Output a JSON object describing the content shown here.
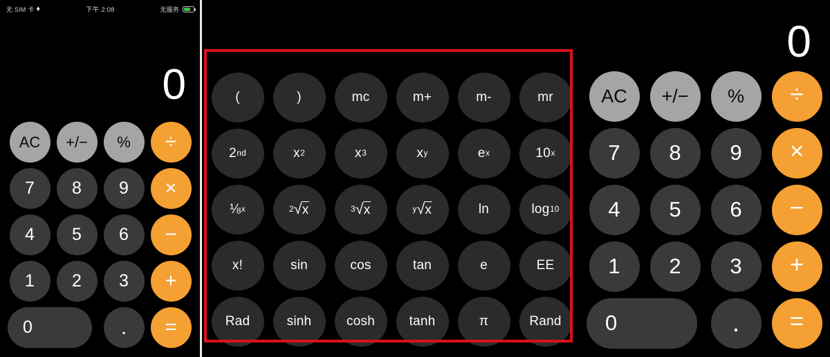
{
  "app": {
    "name": "Calculator",
    "theme": "dark",
    "colors": {
      "background": "#000000",
      "digit_key": "#3a3a3a",
      "function_key": "#a5a5a5",
      "operator_key": "#f5a033",
      "scientific_key": "#2b2b2b",
      "display_text": "#ffffff",
      "highlight_box": "#d9111b",
      "divider": "#e9e9e9",
      "battery_fill": "#39c24a"
    }
  },
  "status_bar": {
    "carrier": "无 SIM 卡",
    "wifi_icon": "wifi-icon",
    "time": "下午 2:08",
    "signal": "无服务",
    "battery_icon": "battery-icon",
    "battery_level_percent": 55
  },
  "left_panel": {
    "name": "portrait-calculator",
    "display_value": "0",
    "rows": [
      [
        {
          "label": "AC",
          "kind": "function",
          "icon": "all-clear"
        },
        {
          "label": "+/−",
          "kind": "function",
          "icon": "sign-toggle"
        },
        {
          "label": "%",
          "kind": "function",
          "icon": "percent"
        },
        {
          "label": "÷",
          "kind": "operator",
          "icon": "divide"
        }
      ],
      [
        {
          "label": "7",
          "kind": "digit"
        },
        {
          "label": "8",
          "kind": "digit"
        },
        {
          "label": "9",
          "kind": "digit"
        },
        {
          "label": "×",
          "kind": "operator",
          "icon": "multiply"
        }
      ],
      [
        {
          "label": "4",
          "kind": "digit"
        },
        {
          "label": "5",
          "kind": "digit"
        },
        {
          "label": "6",
          "kind": "digit"
        },
        {
          "label": "−",
          "kind": "operator",
          "icon": "minus"
        }
      ],
      [
        {
          "label": "1",
          "kind": "digit"
        },
        {
          "label": "2",
          "kind": "digit"
        },
        {
          "label": "3",
          "kind": "digit"
        },
        {
          "label": "+",
          "kind": "operator",
          "icon": "plus"
        }
      ],
      [
        {
          "label": "0",
          "kind": "digit",
          "wide": true
        },
        {
          "label": ".",
          "kind": "digit",
          "icon": "decimal-point"
        },
        {
          "label": "=",
          "kind": "operator",
          "icon": "equals"
        }
      ]
    ]
  },
  "scientific_panel": {
    "name": "scientific-keypad",
    "highlighted": true,
    "rows": [
      [
        {
          "label": "(",
          "name": "open-paren"
        },
        {
          "label": ")",
          "name": "close-paren"
        },
        {
          "label": "mc",
          "name": "memory-clear"
        },
        {
          "label": "m+",
          "name": "memory-add"
        },
        {
          "label": "m-",
          "name": "memory-subtract"
        },
        {
          "label": "mr",
          "name": "memory-recall"
        }
      ],
      [
        {
          "label": "2nd",
          "base": "2",
          "sup": "nd",
          "name": "second-function"
        },
        {
          "label": "x²",
          "base": "x",
          "sup": "2",
          "name": "x-squared"
        },
        {
          "label": "x³",
          "base": "x",
          "sup": "3",
          "name": "x-cubed"
        },
        {
          "label": "xʸ",
          "base": "x",
          "sup": "y",
          "name": "x-power-y"
        },
        {
          "label": "eˣ",
          "base": "e",
          "sup": "x",
          "name": "e-power-x"
        },
        {
          "label": "10ˣ",
          "base": "10",
          "sup": "x",
          "name": "ten-power-x"
        }
      ],
      [
        {
          "label": "1/x",
          "name": "reciprocal"
        },
        {
          "label": "²√x",
          "index": "2",
          "name": "square-root"
        },
        {
          "label": "³√x",
          "index": "3",
          "name": "cube-root"
        },
        {
          "label": "ʸ√x",
          "index": "y",
          "name": "nth-root"
        },
        {
          "label": "ln",
          "name": "natural-log"
        },
        {
          "label": "log₁₀",
          "base": "log",
          "sub": "10",
          "name": "log-base-ten"
        }
      ],
      [
        {
          "label": "x!",
          "name": "factorial"
        },
        {
          "label": "sin",
          "name": "sine"
        },
        {
          "label": "cos",
          "name": "cosine"
        },
        {
          "label": "tan",
          "name": "tangent"
        },
        {
          "label": "e",
          "name": "euler-constant"
        },
        {
          "label": "EE",
          "name": "exponent-entry"
        }
      ],
      [
        {
          "label": "Rad",
          "name": "radian-mode"
        },
        {
          "label": "sinh",
          "name": "hyperbolic-sine"
        },
        {
          "label": "cosh",
          "name": "hyperbolic-cosine"
        },
        {
          "label": "tanh",
          "name": "hyperbolic-tangent"
        },
        {
          "label": "π",
          "name": "pi-constant"
        },
        {
          "label": "Rand",
          "name": "random-number"
        }
      ]
    ]
  },
  "right_panel": {
    "name": "landscape-calculator-numpad",
    "display_value": "0",
    "rows": [
      [
        {
          "label": "AC",
          "kind": "function",
          "icon": "all-clear"
        },
        {
          "label": "+/−",
          "kind": "function",
          "icon": "sign-toggle"
        },
        {
          "label": "%",
          "kind": "function",
          "icon": "percent"
        },
        {
          "label": "÷",
          "kind": "operator",
          "icon": "divide"
        }
      ],
      [
        {
          "label": "7",
          "kind": "digit"
        },
        {
          "label": "8",
          "kind": "digit"
        },
        {
          "label": "9",
          "kind": "digit"
        },
        {
          "label": "×",
          "kind": "operator",
          "icon": "multiply"
        }
      ],
      [
        {
          "label": "4",
          "kind": "digit"
        },
        {
          "label": "5",
          "kind": "digit"
        },
        {
          "label": "6",
          "kind": "digit"
        },
        {
          "label": "−",
          "kind": "operator",
          "icon": "minus"
        }
      ],
      [
        {
          "label": "1",
          "kind": "digit"
        },
        {
          "label": "2",
          "kind": "digit"
        },
        {
          "label": "3",
          "kind": "digit"
        },
        {
          "label": "+",
          "kind": "operator",
          "icon": "plus"
        }
      ],
      [
        {
          "label": "0",
          "kind": "digit",
          "wide": true
        },
        {
          "label": ".",
          "kind": "digit",
          "icon": "decimal-point"
        },
        {
          "label": "=",
          "kind": "operator",
          "icon": "equals"
        }
      ]
    ]
  }
}
